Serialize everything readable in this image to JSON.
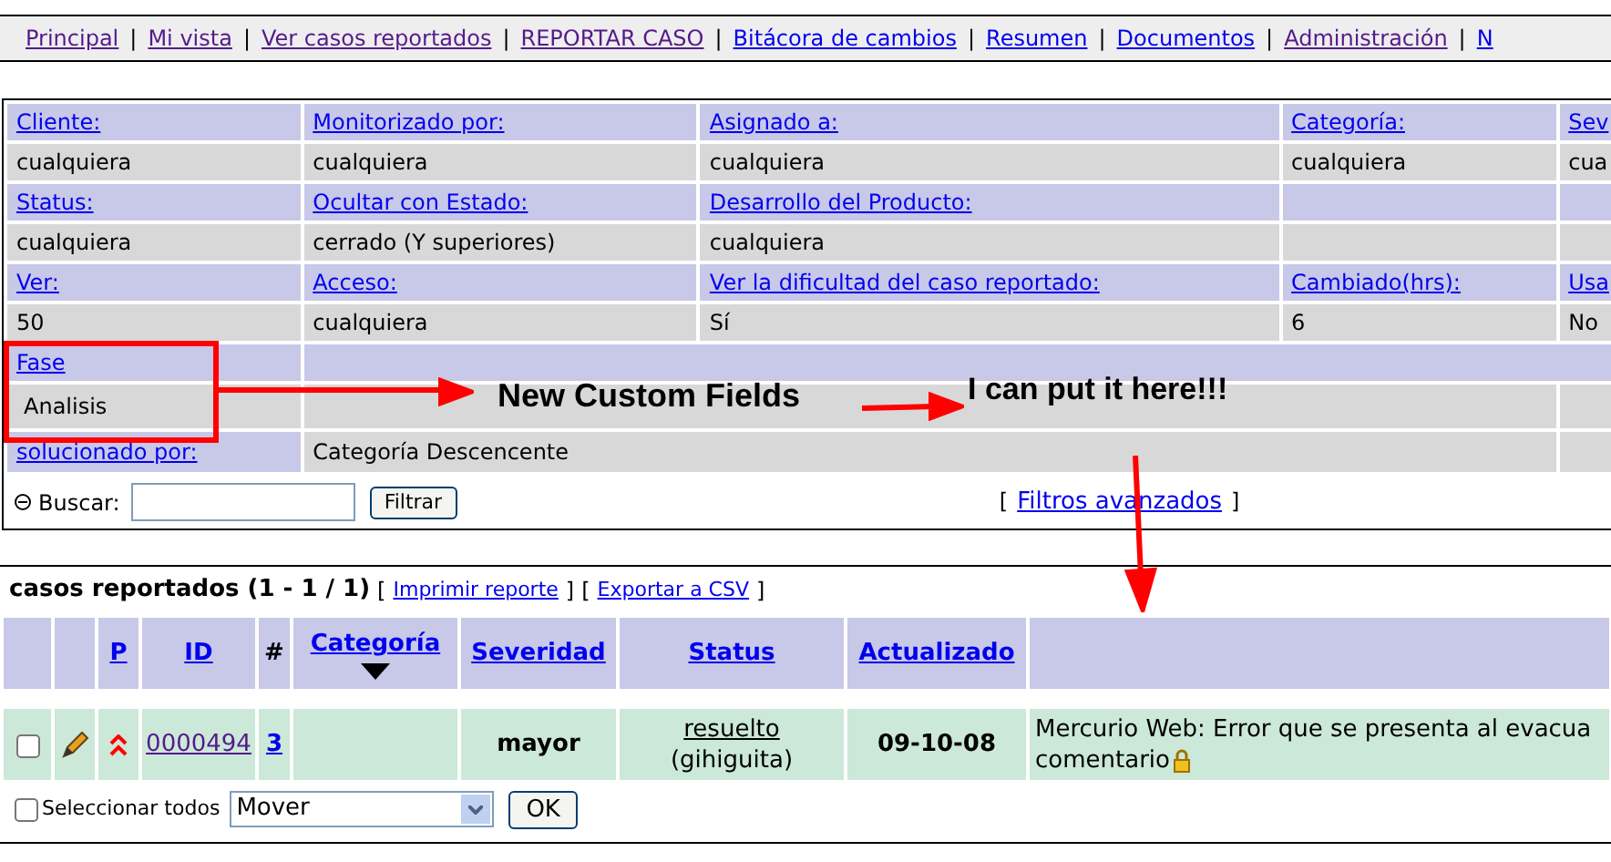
{
  "nav": [
    {
      "label": "Principal",
      "visited": true
    },
    {
      "separator": "|",
      "label": "Mi vista",
      "visited": true
    },
    {
      "separator": "|",
      "label": "Ver casos reportados",
      "visited": true
    },
    {
      "separator": "|",
      "label": "REPORTAR CASO",
      "visited": true
    },
    {
      "separator": "|",
      "label": "Bitácora de cambios",
      "visited": false
    },
    {
      "separator": "|",
      "label": "Resumen",
      "visited": false
    },
    {
      "separator": "|",
      "label": "Documentos",
      "visited": false
    },
    {
      "separator": "|",
      "label": "Administración",
      "visited": true
    },
    {
      "separator": "|",
      "label": "N",
      "visited": false
    }
  ],
  "filters": [
    {
      "headers": [
        "Cliente:",
        "Monitorizado por:",
        "Asignado a:",
        "Categoría:",
        "Sev"
      ],
      "values": [
        "cualquiera",
        "cualquiera",
        "cualquiera",
        "cualquiera",
        "cua"
      ]
    },
    {
      "headers": [
        "Status:",
        "Ocultar con Estado:",
        "Desarrollo del Producto:"
      ],
      "values": [
        "cualquiera",
        "cerrado (Y superiores)",
        "cualquiera"
      ]
    },
    {
      "headers": [
        "Ver:",
        "Acceso:",
        "Ver la dificultad del caso reportado:",
        "Cambiado(hrs):",
        "Usa"
      ],
      "values": [
        "50",
        "cualquiera",
        "Sí",
        "6",
        "No"
      ]
    }
  ],
  "custom_field": {
    "label": "Fase",
    "value": "Analisis"
  },
  "sort": {
    "label": "solucionado por:",
    "value": "Categoría Descencente"
  },
  "search": {
    "label": "Buscar:",
    "button": "Filtrar",
    "advanced_open": "[",
    "advanced": "Filtros avanzados",
    "advanced_close": "]"
  },
  "annotations": [
    "New Custom Fields",
    "I can put it here!!!"
  ],
  "results": {
    "title": "casos reportados (1 - 1 / 1)",
    "links": [
      {
        "open": "[",
        "label": "Imprimir reporte",
        "close": "]"
      },
      {
        "open": "[",
        "label": "Exportar a CSV",
        "close": "]"
      }
    ],
    "columns": [
      {
        "label": "P",
        "kind": "link",
        "sorted": false
      },
      {
        "label": "ID",
        "kind": "link",
        "sorted": false
      },
      {
        "label": "#",
        "kind": "plain",
        "sorted": false
      },
      {
        "label": "Categoría",
        "kind": "link",
        "sorted": true
      },
      {
        "label": "Severidad",
        "kind": "link",
        "sorted": false
      },
      {
        "label": "Status",
        "kind": "link",
        "sorted": false
      },
      {
        "label": "Actualizado",
        "kind": "link",
        "sorted": false
      }
    ],
    "rows": [
      {
        "checked": false,
        "id": "0000494",
        "notes": "3",
        "category": "",
        "severity": "mayor",
        "status": "resuelto",
        "handler": "(gihiguita)",
        "updated": "09-10-08",
        "summary": "Mercurio Web: Error que se presenta al evacua",
        "summary_2": "comentario"
      }
    ]
  },
  "footer": {
    "select_all": "Seleccionar todos",
    "checked": false,
    "action": "Mover",
    "button": "OK"
  }
}
